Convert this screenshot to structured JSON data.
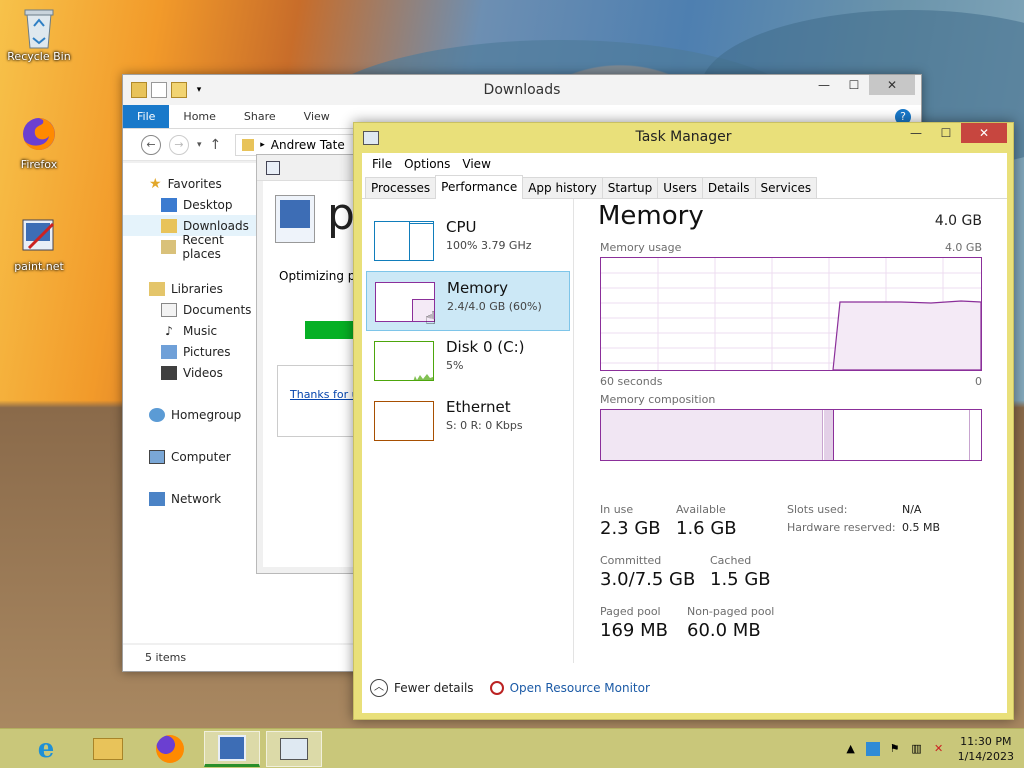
{
  "desktop": {
    "icons": [
      {
        "label": "Recycle Bin"
      },
      {
        "label": "Firefox"
      },
      {
        "label": "paint.net"
      }
    ]
  },
  "explorer": {
    "title": "Downloads",
    "ribbon_tabs": [
      "File",
      "Home",
      "Share",
      "View"
    ],
    "address": "Andrew Tate",
    "nav": {
      "favorites": "Favorites",
      "desktop": "Desktop",
      "downloads": "Downloads",
      "recent": "Recent places",
      "libraries": "Libraries",
      "documents": "Documents",
      "music": "Music",
      "pictures": "Pictures",
      "videos": "Videos",
      "homegroup": "Homegroup",
      "computer": "Computer",
      "network": "Network"
    },
    "status": "5 items"
  },
  "installer": {
    "big_letter": "p",
    "status_text": "Optimizing pa",
    "link_text": "Thanks for us",
    "progress": 0.6
  },
  "taskmgr": {
    "title": "Task Manager",
    "menu": [
      "File",
      "Options",
      "View"
    ],
    "tabs": [
      "Processes",
      "Performance",
      "App history",
      "Startup",
      "Users",
      "Details",
      "Services"
    ],
    "active_tab": "Performance",
    "items": [
      {
        "name": "CPU",
        "sub": "100%  3.79 GHz",
        "color": "#117dbb"
      },
      {
        "name": "Memory",
        "sub": "2.4/4.0 GB (60%)",
        "color": "#8b2f9a"
      },
      {
        "name": "Disk 0 (C:)",
        "sub": "5%",
        "color": "#4da60c"
      },
      {
        "name": "Ethernet",
        "sub": "S: 0  R: 0 Kbps",
        "color": "#a74f01"
      }
    ],
    "memory": {
      "title": "Memory",
      "total": "4.0 GB",
      "usage_label": "Memory usage",
      "usage_max": "4.0 GB",
      "time_left": "60 seconds",
      "time_right": "0",
      "composition_label": "Memory composition",
      "in_use_label": "In use",
      "in_use": "2.3 GB",
      "available_label": "Available",
      "available": "1.6 GB",
      "committed_label": "Committed",
      "committed": "3.0/7.5 GB",
      "cached_label": "Cached",
      "cached": "1.5 GB",
      "paged_label": "Paged pool",
      "paged": "169 MB",
      "nonpaged_label": "Non-paged pool",
      "nonpaged": "60.0 MB",
      "slots_label": "Slots used:",
      "slots": "N/A",
      "hwres_label": "Hardware reserved:",
      "hwres": "0.5 MB"
    },
    "footer": {
      "fewer": "Fewer details",
      "resmon": "Open Resource Monitor"
    }
  },
  "taskbar": {
    "clock_time": "11:30 PM",
    "clock_date": "1/14/2023"
  }
}
